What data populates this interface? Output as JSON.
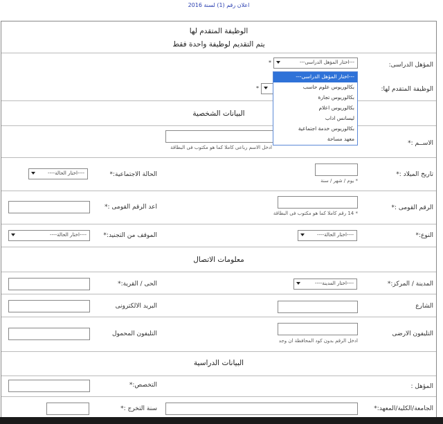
{
  "header": {
    "notice": "اعلان رقم (1) لسنة 2016"
  },
  "job_section": {
    "title": "الوظيفة المتقدم لها",
    "subtitle": "يتم التقديم لوظيفة واحدة فقط",
    "qualification_label": "المؤهل الدراسى:",
    "qualification_select": "---اختار المؤهل الدراسى---",
    "qualification_options": [
      "---اختار المؤهل الدراسى---",
      "بكالوريوس علوم حاسب",
      "بكالوريوس تجارة",
      "بكالوريوس اعلام",
      "ليسانس اداب",
      "بكالوريوس خدمة اجتماعية",
      "معهد مساحة"
    ],
    "job_label": "الوظيفة المتقدم لها:"
  },
  "personal": {
    "title": "البيانات الشخصية",
    "name_label": "الاســم :*",
    "name_hint": "ادخل الاسم رباعى كاملا كما هو مكتوب فى البطاقة",
    "birth_label": "تاريخ الميلاد :*",
    "birth_hint": "* يوم / شهر / سنة",
    "marital_label": "الحالة الاجتماعية:*",
    "marital_select": "----اختار الحالة----",
    "national_id_label": "الرقم القومى :*",
    "national_id_hint": "* 14 رقم كاملا كما هو مكتوب فى البطاقة",
    "confirm_id_label": "اعد الرقم القومى :*",
    "gender_label": "النوع:*",
    "gender_select": "----اختار الحالة----",
    "military_label": "الموقف من التجنيد:*",
    "military_select": "----اختار الحالة----"
  },
  "contact": {
    "title": "معلومات الاتصال",
    "city_label": "المدينة / المركز:*",
    "city_select": "----اختار المدينة----",
    "district_label": "الحى / القرية:*",
    "street_label": "الشارع",
    "email_label": "البريد الالكترونى",
    "landline_label": "التليفون الارضى",
    "landline_hint": "ادخل الرقم بدون كود المحافظة ان وجد",
    "mobile_label": "التليفون المحمول"
  },
  "education": {
    "title": "البيانات الدراسية",
    "qualification_label": "المؤهل :",
    "specialization_label": "التخصص:*",
    "university_label": "الجامعة/الكلية/المعهد:*",
    "graduation_label": "سنة التخرج :*"
  },
  "symbols": {
    "required_star": "*"
  },
  "colors": {
    "accent": "#2f72d8",
    "notice": "#2a3fb0"
  }
}
